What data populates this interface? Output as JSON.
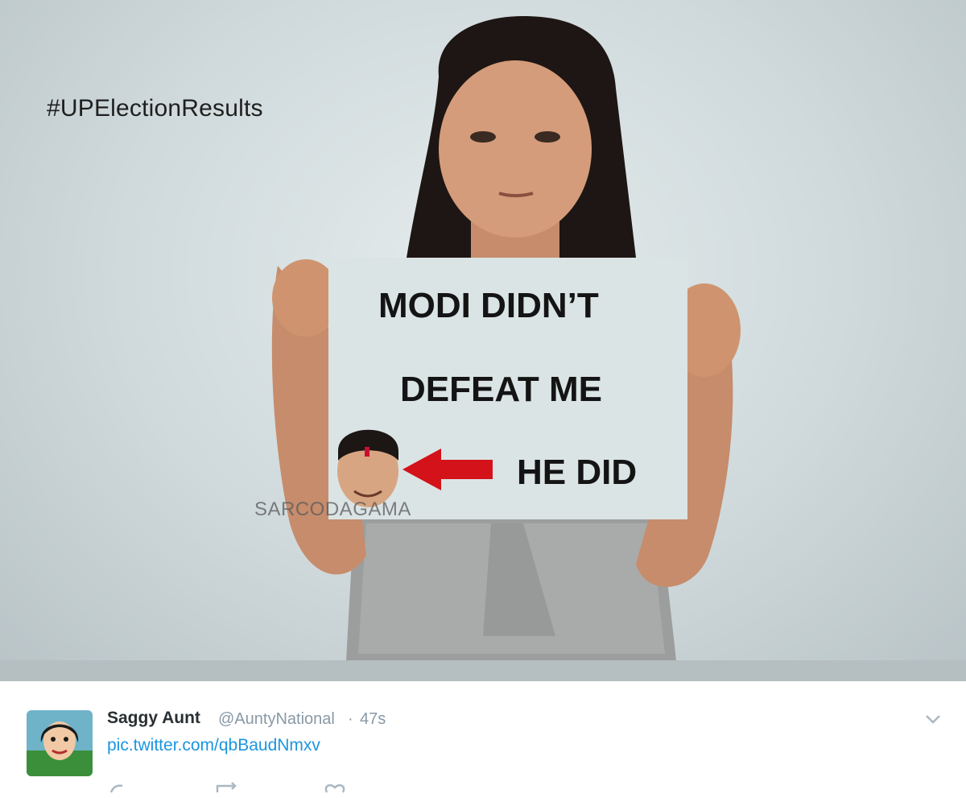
{
  "image": {
    "hashtag": "#UPElectionResults",
    "sign_lines": [
      "MODI DIDN’T",
      "DEFEAT ME",
      "HE DID"
    ],
    "watermark": "SARCODAGAMA",
    "arrow_color": "#d4121a"
  },
  "tweet": {
    "author_name": "Saggy Aunt",
    "author_handle": "@AuntyNational",
    "separator": "·",
    "time": "47s",
    "link_text": "pic.twitter.com/qbBaudNmxv",
    "link_color": "#1b95e0",
    "menu_icon": "chevron-down-icon",
    "action_icons": [
      "reply-icon",
      "retweet-icon",
      "like-icon"
    ]
  }
}
